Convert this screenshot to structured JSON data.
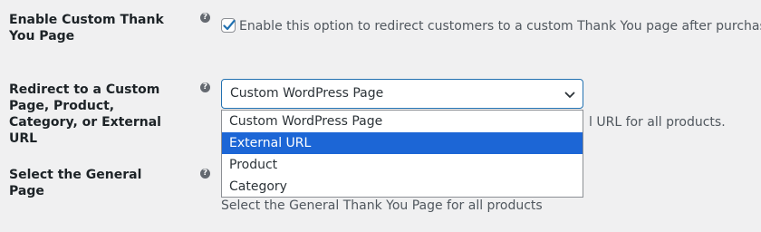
{
  "rows": [
    {
      "label": "Enable Custom Thank You Page",
      "help": "?",
      "checkbox_checked": true,
      "description": "Enable this option to redirect customers to a custom Thank You page after purchase."
    },
    {
      "label": "Redirect to a Custom Page, Product, Category, or External URL",
      "help": "?",
      "select_value": "Custom WordPress Page",
      "description_visible": "l URL for all products.",
      "options": [
        "Custom WordPress Page",
        "External URL",
        "Product",
        "Category"
      ],
      "highlighted_option": "External URL"
    },
    {
      "label": "Select the General Page",
      "help": "?",
      "description": "Select the General Thank You Page for all products"
    }
  ],
  "colors": {
    "background": "#f0f0f1",
    "select_border": "#2271b1",
    "highlight": "#1c66d6"
  },
  "icons": [
    "help-icon",
    "checkmark-icon",
    "chevron-down-icon"
  ]
}
